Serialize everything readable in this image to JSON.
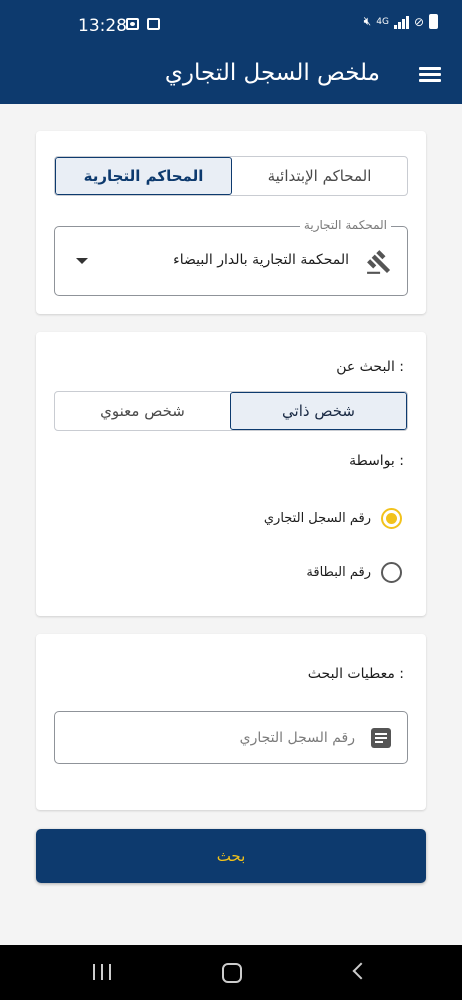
{
  "status_bar": {
    "time": "13:28",
    "network": "4G",
    "icons": [
      "image-icon",
      "app-notification-icon",
      "mute-icon",
      "signal-icon",
      "no-disturb-icon",
      "battery-icon"
    ]
  },
  "app_bar": {
    "title": "ملخص السجل التجاري",
    "menu_icon": "hamburger-menu-icon"
  },
  "court_type": {
    "options": [
      "المحاكم الإبتدائية",
      "المحاكم التجارية"
    ],
    "selected": "المحاكم التجارية"
  },
  "court_select": {
    "label": "المحكمة التجارية",
    "value": "المحكمة التجارية بالدار البيضاء",
    "icon": "gavel-icon"
  },
  "search_for": {
    "label": "البحث عن :",
    "options": [
      "شخص ذاتي",
      "شخص معنوي"
    ],
    "selected": "شخص ذاتي"
  },
  "search_by": {
    "label": "بواسطة :",
    "options": [
      {
        "label": "رقم السجل التجاري",
        "checked": true
      },
      {
        "label": "رقم البطاقة",
        "checked": false
      }
    ]
  },
  "search_data": {
    "label": "معطيات البحث :",
    "placeholder": "رقم السجل التجاري",
    "icon": "note-icon"
  },
  "search_button": {
    "label": "بحث"
  },
  "colors": {
    "primary": "#0d3a6e",
    "accent": "#f2c21b",
    "background": "#f4f4f4"
  }
}
